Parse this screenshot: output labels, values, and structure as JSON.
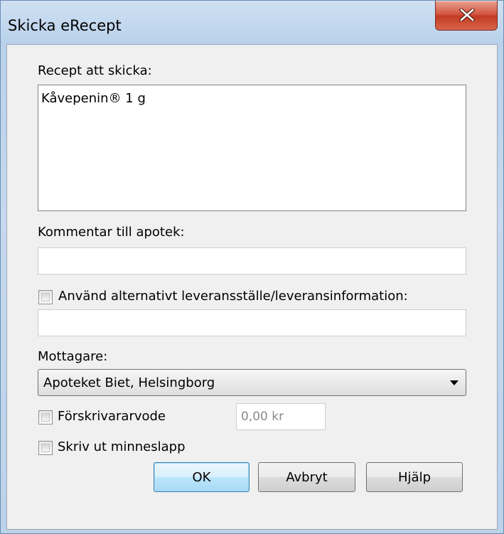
{
  "window": {
    "title": "Skicka eRecept"
  },
  "labels": {
    "recipes": "Recept att skicka:",
    "comment": "Kommentar till apotek:",
    "alt_delivery": "Använd alternativt leveransställe/leveransinformation:",
    "recipient": "Mottagare:",
    "fee": "Förskrivararvode",
    "print": "Skriv ut minneslapp"
  },
  "recipes": [
    "Kåvepenin® 1 g"
  ],
  "fields": {
    "comment_value": "",
    "alt_delivery_value": "",
    "recipient_selected": "Apoteket Biet, Helsingborg",
    "fee_value": "0,00 kr"
  },
  "checkboxes": {
    "alt_delivery": false,
    "fee": false,
    "print": false
  },
  "buttons": {
    "ok": "OK",
    "cancel": "Avbryt",
    "help": "Hjälp"
  },
  "icons": {
    "close": "close-icon",
    "dropdown": "chevron-down-icon"
  },
  "colors": {
    "close_button": "#c9432c",
    "default_button_border": "#3c7fb1",
    "window_frame": "#b9d1ea"
  }
}
